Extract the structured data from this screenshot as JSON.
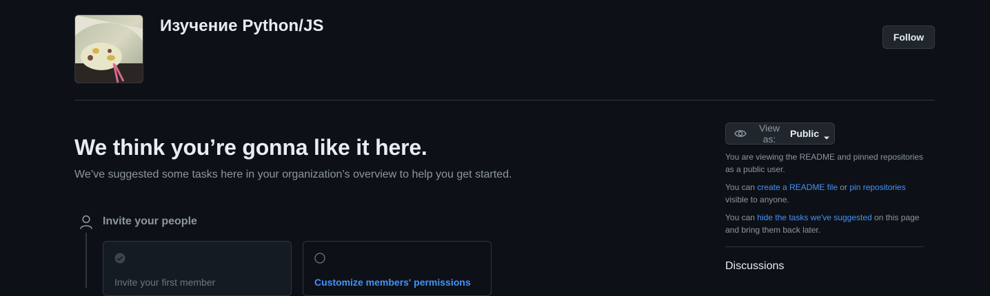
{
  "header": {
    "org_name": "Изучение Python/JS",
    "follow_label": "Follow",
    "avatar_alt": "snake photo"
  },
  "welcome": {
    "headline": "We think you’re gonna like it here.",
    "subhead": "We’ve suggested some tasks here in your organization’s overview to help you get started."
  },
  "tasks": {
    "group_title": "Invite your people",
    "cards": [
      {
        "label": "Invite your first member",
        "state": "done"
      },
      {
        "label": "Customize members' permissions",
        "state": "todo"
      }
    ]
  },
  "sidebar": {
    "view_as_prefix": "View as:",
    "view_as_value": "Public",
    "note1": "You are viewing the README and pinned repositories as a public user.",
    "note2_prefix": "You can",
    "note2_link1": "create a README file",
    "note2_mid": "or",
    "note2_link2": "pin repositories",
    "note2_suffix": "visible to anyone.",
    "note3_prefix": "You can",
    "note3_link": "hide the tasks we've suggested",
    "note3_suffix": "on this page and bring them back later.",
    "discussions_title": "Discussions"
  },
  "colors": {
    "background": "#0d1117",
    "text": "#e6edf3",
    "muted": "#8d96a0",
    "link": "#4493f8",
    "border": "#30363d"
  }
}
